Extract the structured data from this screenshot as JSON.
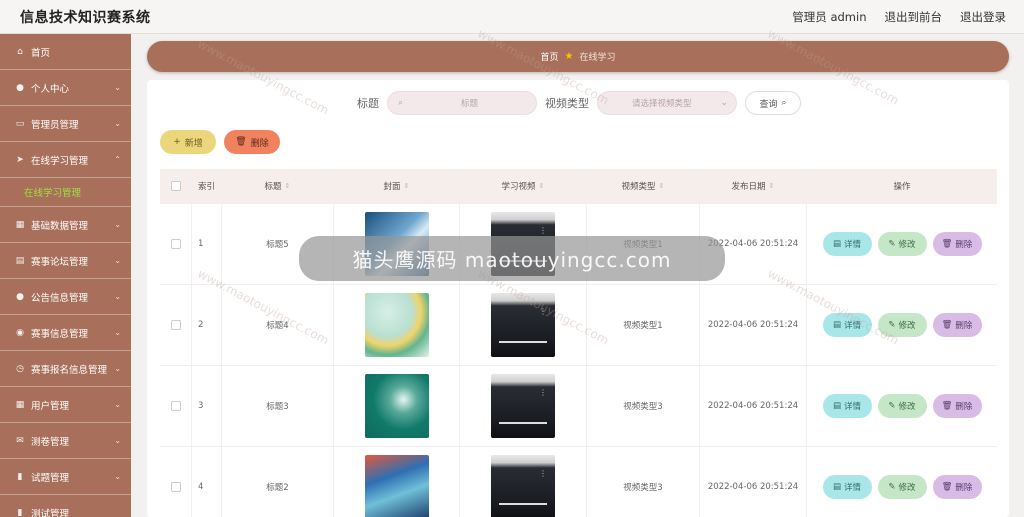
{
  "app": {
    "title": "信息技术知识赛系统"
  },
  "top_nav": {
    "user": "管理员 admin",
    "front": "退出到前台",
    "logout": "退出登录"
  },
  "sidebar": {
    "items": [
      {
        "label": "首页",
        "icon": "home-icon"
      },
      {
        "label": "个人中心",
        "icon": "user-icon"
      },
      {
        "label": "管理员管理",
        "icon": "admin-icon"
      },
      {
        "label": "在线学习管理",
        "icon": "send-icon"
      },
      {
        "label": "基础数据管理",
        "icon": "grid-icon"
      },
      {
        "label": "赛事论坛管理",
        "icon": "forum-icon"
      },
      {
        "label": "公告信息管理",
        "icon": "user-icon"
      },
      {
        "label": "赛事信息管理",
        "icon": "pin-icon"
      },
      {
        "label": "赛事报名信息管理",
        "icon": "clock-icon"
      },
      {
        "label": "用户管理",
        "icon": "grid-icon"
      },
      {
        "label": "测卷管理",
        "icon": "mail-icon"
      },
      {
        "label": "试题管理",
        "icon": "doc-icon"
      },
      {
        "label": "测试管理",
        "icon": "doc-icon"
      }
    ],
    "active_sub": "在线学习管理"
  },
  "breadcrumb": {
    "home": "首页",
    "current": "在线学习"
  },
  "search": {
    "title_label": "标题",
    "title_placeholder": "标题",
    "type_label": "视频类型",
    "type_placeholder": "请选择视频类型",
    "query": "查询"
  },
  "actions": {
    "add": "新增",
    "delete": "删除"
  },
  "table": {
    "headers": {
      "index": "索引",
      "title": "标题",
      "cover": "封面",
      "video": "学习视频",
      "type": "视频类型",
      "date": "发布日期",
      "ops": "操作"
    },
    "rows": [
      {
        "index": "1",
        "title": "标题5",
        "type": "视频类型1",
        "date": "2022-04-06 20:51:24"
      },
      {
        "index": "2",
        "title": "标题4",
        "type": "视频类型1",
        "date": "2022-04-06 20:51:24"
      },
      {
        "index": "3",
        "title": "标题3",
        "type": "视频类型3",
        "date": "2022-04-06 20:51:24"
      },
      {
        "index": "4",
        "title": "标题2",
        "type": "视频类型3",
        "date": "2022-04-06 20:51:24"
      }
    ],
    "ops": {
      "detail": "详情",
      "edit": "修改",
      "delete": "删除"
    }
  },
  "overlay": {
    "text": "猫头鹰源码 maotouyingcc.com"
  },
  "watermark": {
    "text": "www.maotouyingcc.com"
  }
}
